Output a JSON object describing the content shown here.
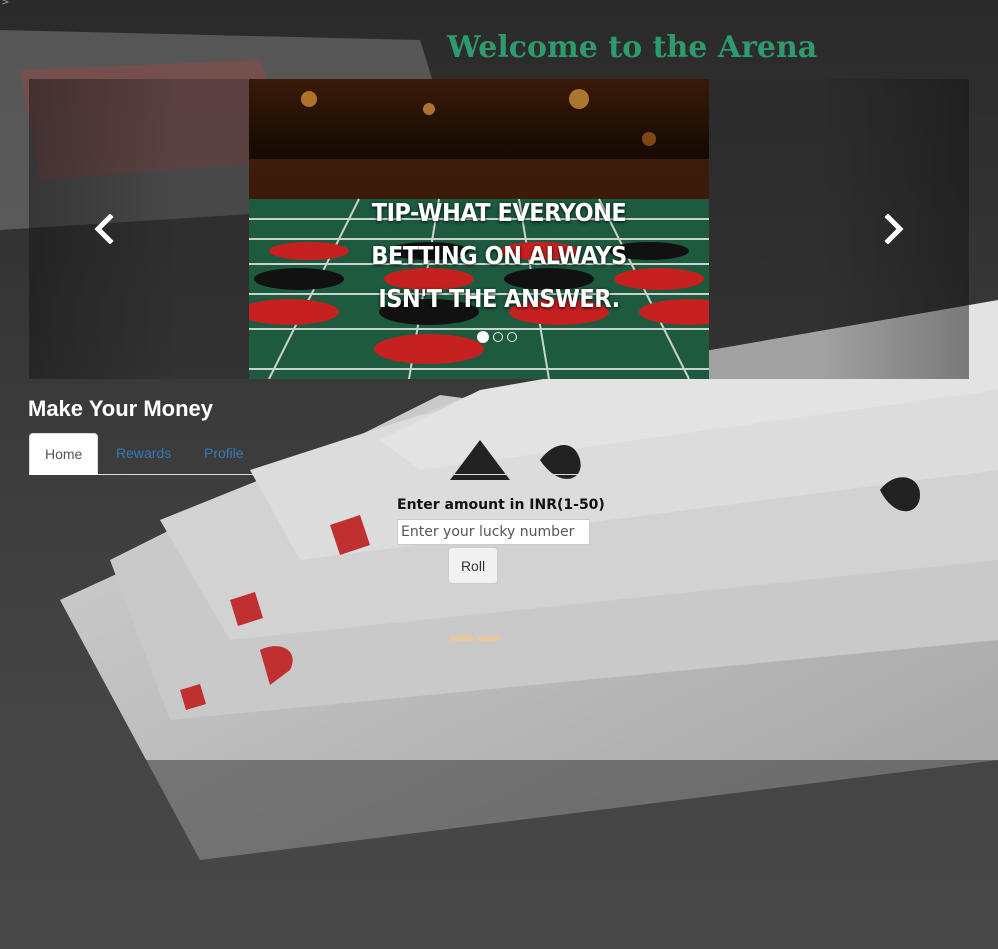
{
  "corner_glyph": ">",
  "header": {
    "title": "Welcome to the Arena"
  },
  "carousel": {
    "caption": "Tip-what everyone betting on always isn't the answer.",
    "indicator_count": 3,
    "active_index": 0
  },
  "section": {
    "title": "Make Your Money"
  },
  "tabs": [
    {
      "label": "Home",
      "active": true
    },
    {
      "label": "Rewards",
      "active": false
    },
    {
      "label": "Profile",
      "active": false
    }
  ],
  "form": {
    "label": "Enter amount in INR(1-50)",
    "input_placeholder": "Enter your lucky number",
    "input_value": "",
    "roll_label": "Roll"
  },
  "colors": {
    "title": "#2e9a6e",
    "tab_link": "#337ab7",
    "result_bar": "#e8c89a"
  },
  "icons": {
    "prev": "chevron-left-icon",
    "next": "chevron-right-icon"
  }
}
